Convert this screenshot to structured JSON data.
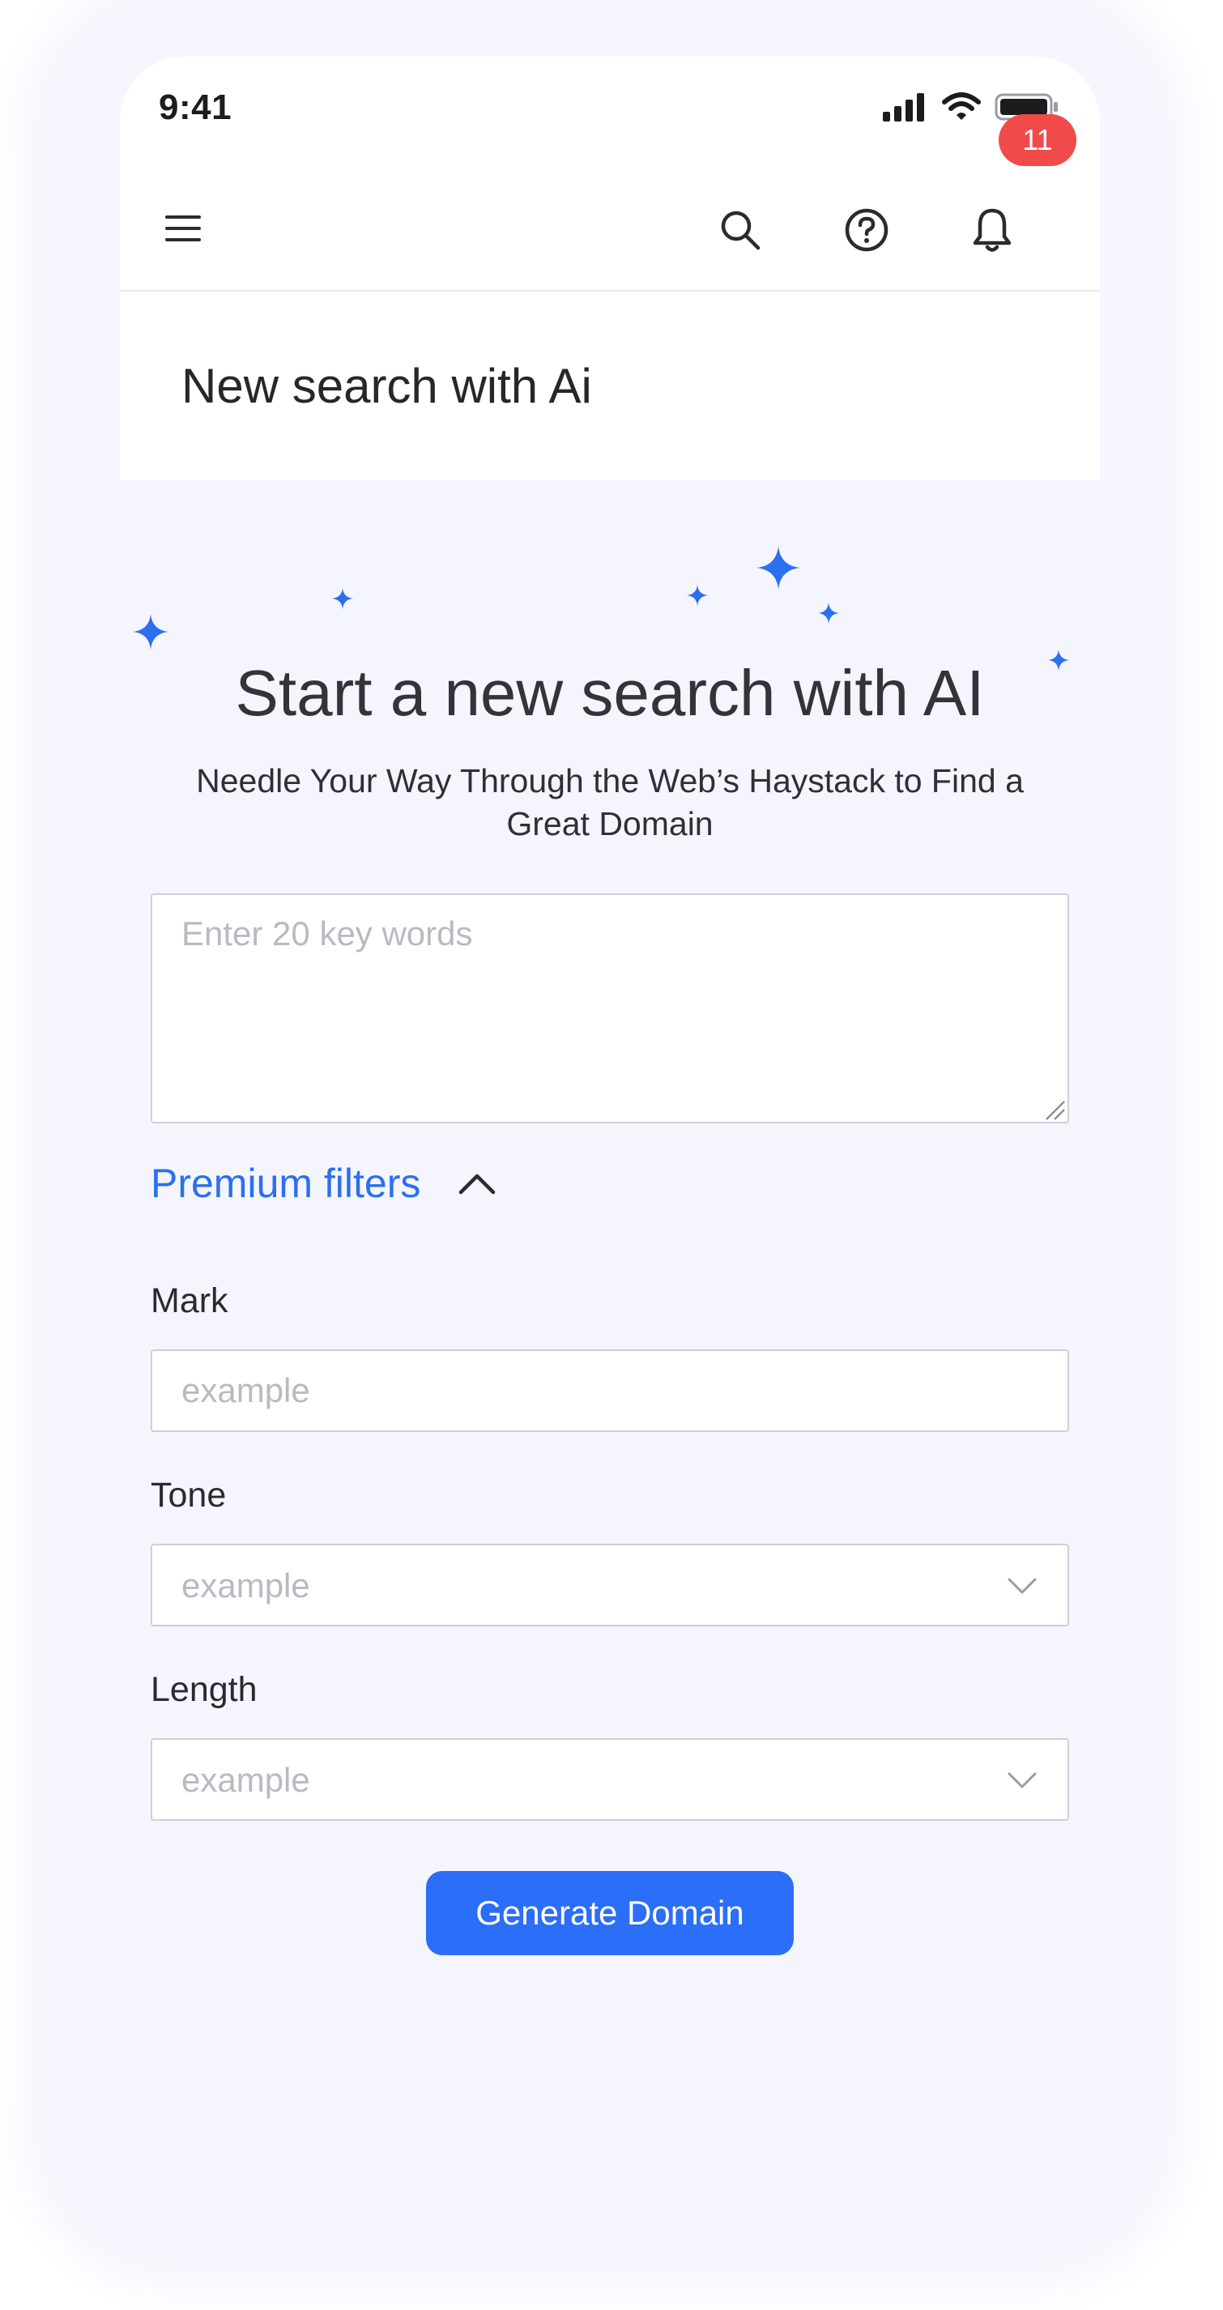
{
  "status_bar": {
    "time": "9:41"
  },
  "app_bar": {
    "notification_count": "11"
  },
  "header": {
    "title": "New search with Ai"
  },
  "hero": {
    "title": "Start a new search with AI",
    "subtitle": "Needle Your Way Through the Web’s Haystack to Find a Great Domain"
  },
  "keywords": {
    "placeholder": "Enter 20 key words",
    "value": ""
  },
  "premium_filters": {
    "label": "Premium filters",
    "expanded": true
  },
  "fields": {
    "mark": {
      "label": "Mark",
      "placeholder": "example"
    },
    "tone": {
      "label": "Tone",
      "placeholder": "example"
    },
    "length": {
      "label": "Length",
      "placeholder": "example"
    }
  },
  "actions": {
    "generate_label": "Generate Domain"
  },
  "colors": {
    "accent": "#2b6ef7",
    "link": "#2c6ff0",
    "badge": "#f04a4a",
    "background": "#f4f5fd"
  },
  "icons": {
    "menu": "hamburger-menu-icon",
    "search": "search-icon",
    "help": "question-circle-icon",
    "notifications": "bell-icon",
    "sparkles": "sparkle-icon",
    "chevron_up": "chevron-up-icon",
    "chevron_down": "chevron-down-icon"
  }
}
